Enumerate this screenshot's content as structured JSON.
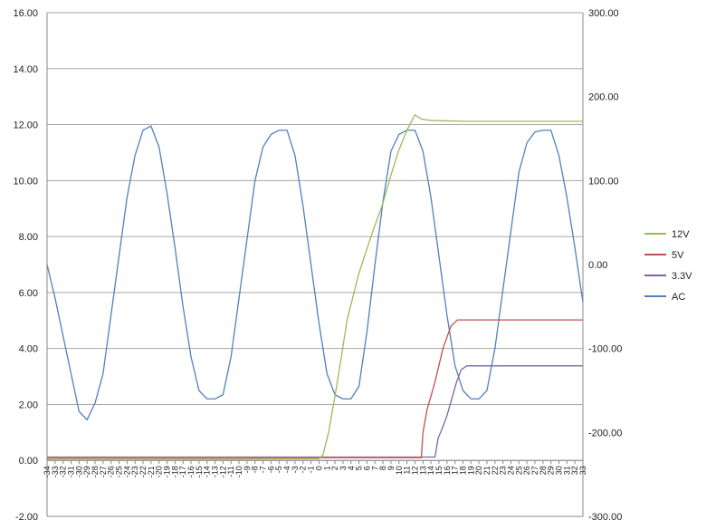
{
  "chart_data": {
    "type": "line",
    "title": "",
    "xlabel": "",
    "ylabel": "",
    "grid": true,
    "legend_position": "right",
    "x_categories_range": [
      -34,
      33
    ],
    "y_left": {
      "min": -2,
      "max": 16,
      "step": 2,
      "tick_labels": [
        "-2.00",
        "0.00",
        "2.00",
        "4.00",
        "6.00",
        "8.00",
        "10.00",
        "12.00",
        "14.00",
        "16.00"
      ]
    },
    "y_right": {
      "min": -300,
      "max": 300,
      "step": 100,
      "tick_labels": [
        "-300.00",
        "-200.00",
        "-100.00",
        "0.00",
        "100.00",
        "200.00",
        "300.00"
      ]
    },
    "series": [
      {
        "name": "12V",
        "color": "#9BBB59",
        "axis": "left",
        "points": [
          [
            -34,
            0.05
          ],
          [
            -10,
            0.05
          ],
          [
            0,
            0.06
          ],
          [
            0.5,
            0.2
          ],
          [
            1.2,
            1.0
          ],
          [
            2,
            2.3
          ],
          [
            2.8,
            3.7
          ],
          [
            3.5,
            5.0
          ],
          [
            5,
            6.7
          ],
          [
            6.5,
            8.0
          ],
          [
            8,
            9.2
          ],
          [
            9,
            10.2
          ],
          [
            10,
            11.1
          ],
          [
            11,
            11.8
          ],
          [
            12,
            12.35
          ],
          [
            12.8,
            12.2
          ],
          [
            14,
            12.15
          ],
          [
            18,
            12.12
          ],
          [
            33,
            12.12
          ]
        ]
      },
      {
        "name": "5V",
        "color": "#C0504D",
        "axis": "left",
        "points": [
          [
            -34,
            0.1
          ],
          [
            12.8,
            0.1
          ],
          [
            13.0,
            1.0
          ],
          [
            13.5,
            1.8
          ],
          [
            14.5,
            2.8
          ],
          [
            15.5,
            4.0
          ],
          [
            16.5,
            4.8
          ],
          [
            17.3,
            5.02
          ],
          [
            20,
            5.02
          ],
          [
            33,
            5.02
          ]
        ]
      },
      {
        "name": "3.3V",
        "color": "#8064A2",
        "axis": "left",
        "points": [
          [
            -34,
            0.12
          ],
          [
            14.5,
            0.12
          ],
          [
            14.9,
            0.8
          ],
          [
            15.5,
            1.2
          ],
          [
            16,
            1.6
          ],
          [
            16.5,
            2.1
          ],
          [
            17.2,
            2.8
          ],
          [
            17.8,
            3.25
          ],
          [
            18.5,
            3.38
          ],
          [
            33,
            3.38
          ]
        ]
      },
      {
        "name": "AC",
        "color": "#4F81BD",
        "axis": "right",
        "points": [
          [
            -34,
            0
          ],
          [
            -33,
            -40
          ],
          [
            -32,
            -85
          ],
          [
            -31,
            -130
          ],
          [
            -30,
            -175
          ],
          [
            -29,
            -185
          ],
          [
            -28,
            -165
          ],
          [
            -27,
            -130
          ],
          [
            -26,
            -60
          ],
          [
            -25,
            10
          ],
          [
            -24,
            80
          ],
          [
            -23,
            130
          ],
          [
            -22,
            160
          ],
          [
            -21,
            165
          ],
          [
            -20,
            140
          ],
          [
            -19,
            85
          ],
          [
            -18,
            20
          ],
          [
            -17,
            -50
          ],
          [
            -16,
            -110
          ],
          [
            -15,
            -150
          ],
          [
            -14,
            -160
          ],
          [
            -13,
            -160
          ],
          [
            -12,
            -155
          ],
          [
            -11,
            -110
          ],
          [
            -10,
            -40
          ],
          [
            -9,
            30
          ],
          [
            -8,
            100
          ],
          [
            -7,
            140
          ],
          [
            -6,
            155
          ],
          [
            -5,
            160
          ],
          [
            -4,
            160
          ],
          [
            -3,
            130
          ],
          [
            -2,
            70
          ],
          [
            -1,
            0
          ],
          [
            0,
            -70
          ],
          [
            1,
            -130
          ],
          [
            2,
            -155
          ],
          [
            3,
            -160
          ],
          [
            4,
            -160
          ],
          [
            5,
            -145
          ],
          [
            6,
            -80
          ],
          [
            7,
            0
          ],
          [
            8,
            75
          ],
          [
            9,
            135
          ],
          [
            10,
            155
          ],
          [
            11,
            160
          ],
          [
            12,
            160
          ],
          [
            13,
            135
          ],
          [
            14,
            80
          ],
          [
            15,
            10
          ],
          [
            16,
            -60
          ],
          [
            17,
            -120
          ],
          [
            18,
            -150
          ],
          [
            19,
            -160
          ],
          [
            20,
            -160
          ],
          [
            21,
            -150
          ],
          [
            22,
            -100
          ],
          [
            23,
            -30
          ],
          [
            24,
            40
          ],
          [
            25,
            110
          ],
          [
            26,
            145
          ],
          [
            27,
            158
          ],
          [
            28,
            160
          ],
          [
            29,
            160
          ],
          [
            30,
            130
          ],
          [
            31,
            80
          ],
          [
            32,
            20
          ],
          [
            33,
            -45
          ]
        ]
      }
    ]
  }
}
